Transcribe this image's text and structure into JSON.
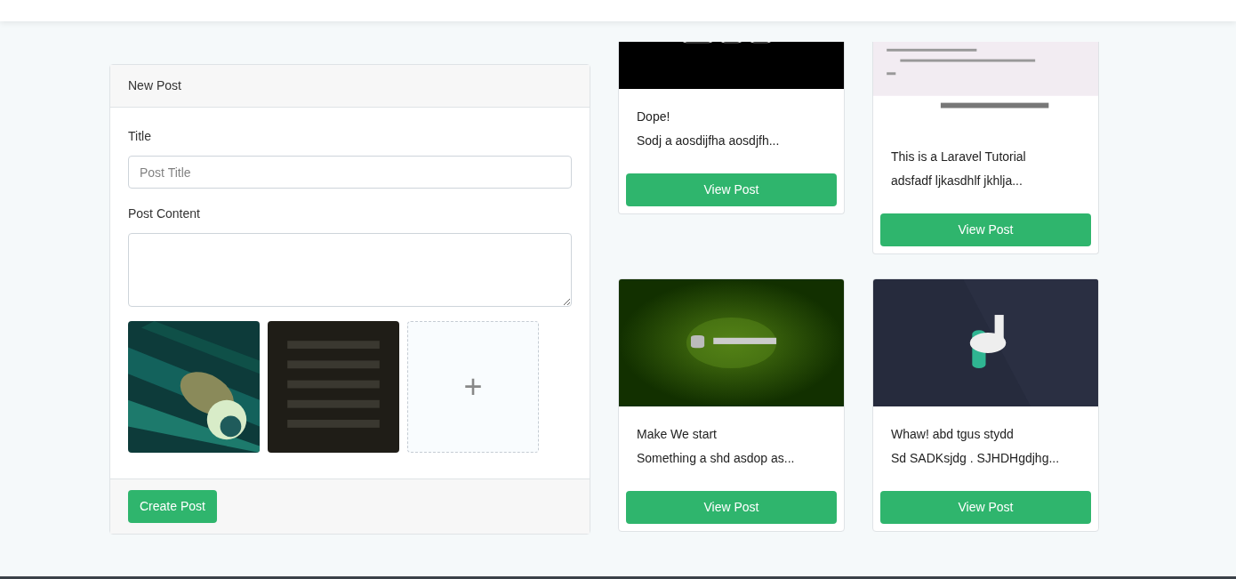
{
  "new_post": {
    "header": "New Post",
    "title_label": "Title",
    "title_placeholder": "Post Title",
    "content_label": "Post Content",
    "attachments": [
      {
        "kind": "picture"
      },
      {
        "kind": "picture"
      },
      {
        "kind": "add",
        "icon": "+"
      }
    ],
    "submit": "Create Post"
  },
  "posts": [
    {
      "title": "Dope!",
      "excerpt": "Sodj a aosdijfha aosdjfh...",
      "button": "View Post"
    },
    {
      "title": "This is a Laravel Tutorial",
      "excerpt": "adsfadf ljkasdhlf jkhlja...",
      "button": "View Post"
    },
    {
      "title": "Make We start",
      "excerpt": "Something a shd asdop as...",
      "button": "View Post"
    },
    {
      "title": "Whaw! abd tgus stydd",
      "excerpt": "Sd SADKsjdg . SJHDHgdjhg...",
      "button": "View Post"
    }
  ]
}
